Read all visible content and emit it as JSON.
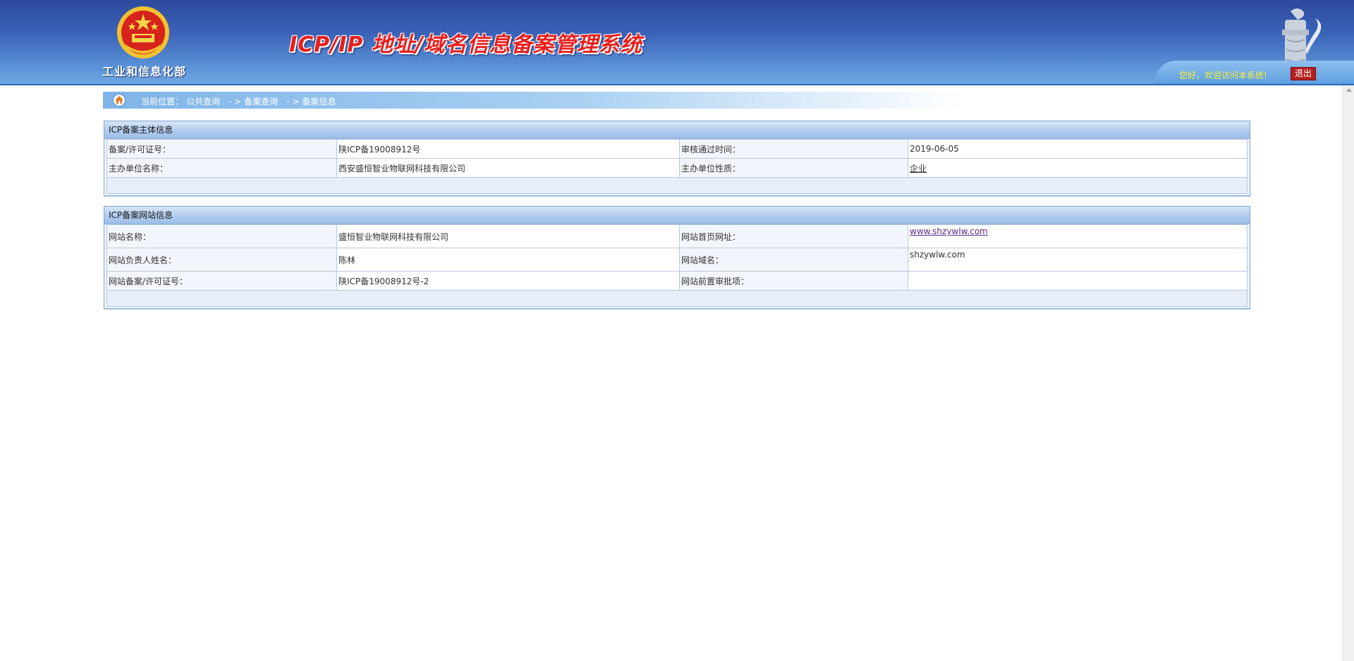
{
  "header": {
    "ministry": "工业和信息化部",
    "title": "ICP/IP 地址/域名信息备案管理系统",
    "welcome": "您好，欢迎访问本系统!",
    "logout_label": "退出"
  },
  "breadcrumb": {
    "prefix": "当前位置：",
    "items": [
      "公共查询",
      "备案查询",
      "备案信息"
    ],
    "separator": "- >"
  },
  "entity_panel": {
    "title": "ICP备案主体信息",
    "rows": [
      {
        "label1": "备案/许可证号：",
        "value1": "陕ICP备19008912号",
        "label2": "审核通过时间：",
        "value2": "2019-06-05"
      },
      {
        "label1": "主办单位名称：",
        "value1": "西安盛恒智业物联网科技有限公司",
        "label2": "主办单位性质：",
        "value2": "企业"
      }
    ]
  },
  "site_panel": {
    "title": "ICP备案网站信息",
    "rows": [
      {
        "label1": "网站名称：",
        "value1": "盛恒智业物联网科技有限公司",
        "label2": "网站首页网址：",
        "value2": "www.shzywlw.com"
      },
      {
        "label1": "网站负责人姓名：",
        "value1": "陈林",
        "label2": "网站域名：",
        "value2": "shzywlw.com"
      },
      {
        "label1": "网站备案/许可证号：",
        "value1": "陕ICP备19008912号-2",
        "label2": "网站前置审批项：",
        "value2": ""
      }
    ]
  },
  "colors": {
    "header_blue": "#3a63b8",
    "title_red": "#e8201d",
    "welcome_yellow": "#f7f23a",
    "logout_red": "#b41f1f",
    "link_purple": "#5a2a87"
  }
}
